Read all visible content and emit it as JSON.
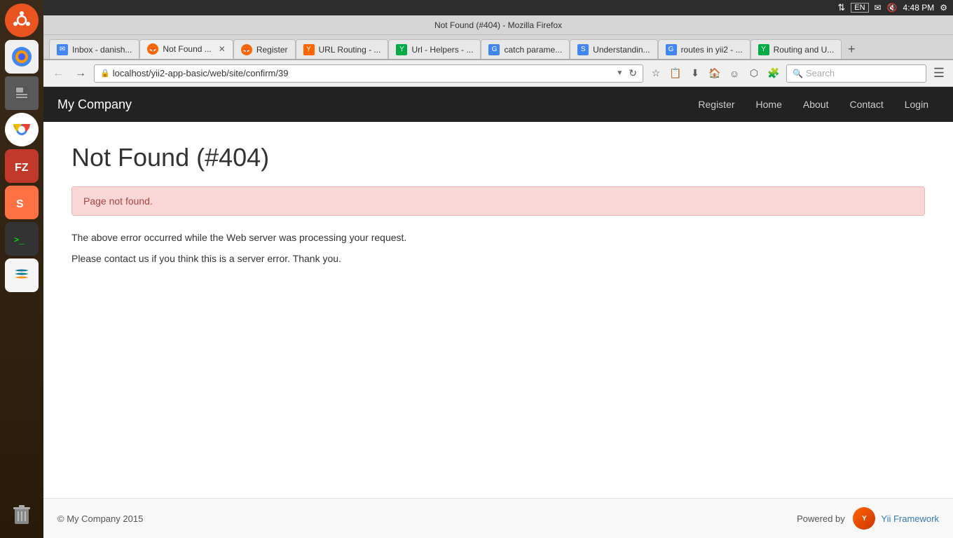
{
  "os": {
    "time": "4:48 PM",
    "lang": "EN"
  },
  "browser": {
    "title": "Not Found (#404) - Mozilla Firefox",
    "tabs": [
      {
        "id": "tab-inbox",
        "label": "Inbox - danish...",
        "icon_color": "#4285f4",
        "icon_text": "✉",
        "active": false,
        "closable": false
      },
      {
        "id": "tab-notfound",
        "label": "Not Found ...",
        "icon_color": "#e95420",
        "icon_text": "🦊",
        "active": true,
        "closable": true
      },
      {
        "id": "tab-register",
        "label": "Register",
        "icon_color": "#e95420",
        "icon_text": "🦊",
        "active": false,
        "closable": false
      },
      {
        "id": "tab-url-routing",
        "label": "URL Routing - ...",
        "icon_color": "#ff6600",
        "icon_text": "Y",
        "active": false,
        "closable": false
      },
      {
        "id": "tab-url-helpers",
        "label": "Url - Helpers - ...",
        "icon_color": "#00aa44",
        "icon_text": "Y",
        "active": false,
        "closable": false
      },
      {
        "id": "tab-catch",
        "label": "catch parame...",
        "icon_color": "#4285f4",
        "icon_text": "G",
        "active": false,
        "closable": false
      },
      {
        "id": "tab-understanding",
        "label": "Understandin...",
        "icon_color": "#4285f4",
        "icon_text": "S",
        "active": false,
        "closable": false
      },
      {
        "id": "tab-routes",
        "label": "routes in yii2 - ...",
        "icon_color": "#4285f4",
        "icon_text": "G",
        "active": false,
        "closable": false
      },
      {
        "id": "tab-routing",
        "label": "Routing and U...",
        "icon_color": "#00aa44",
        "icon_text": "Y",
        "active": false,
        "closable": false
      }
    ],
    "address": "localhost/yii2-app-basic/web/site/confirm/39",
    "search_placeholder": "Search"
  },
  "app": {
    "brand": "My Company",
    "nav": [
      {
        "label": "Register",
        "id": "nav-register"
      },
      {
        "label": "Home",
        "id": "nav-home"
      },
      {
        "label": "About",
        "id": "nav-about"
      },
      {
        "label": "Contact",
        "id": "nav-contact"
      },
      {
        "label": "Login",
        "id": "nav-login"
      }
    ]
  },
  "page": {
    "title": "Not Found (#404)",
    "error_box": "Page not found.",
    "description_line1": "The above error occurred while the Web server was processing your request.",
    "description_line2": "Please contact us if you think this is a server error. Thank you."
  },
  "footer": {
    "copyright": "© My Company 2015",
    "powered_by": "Powered by",
    "framework_link": "Yii Framework"
  }
}
